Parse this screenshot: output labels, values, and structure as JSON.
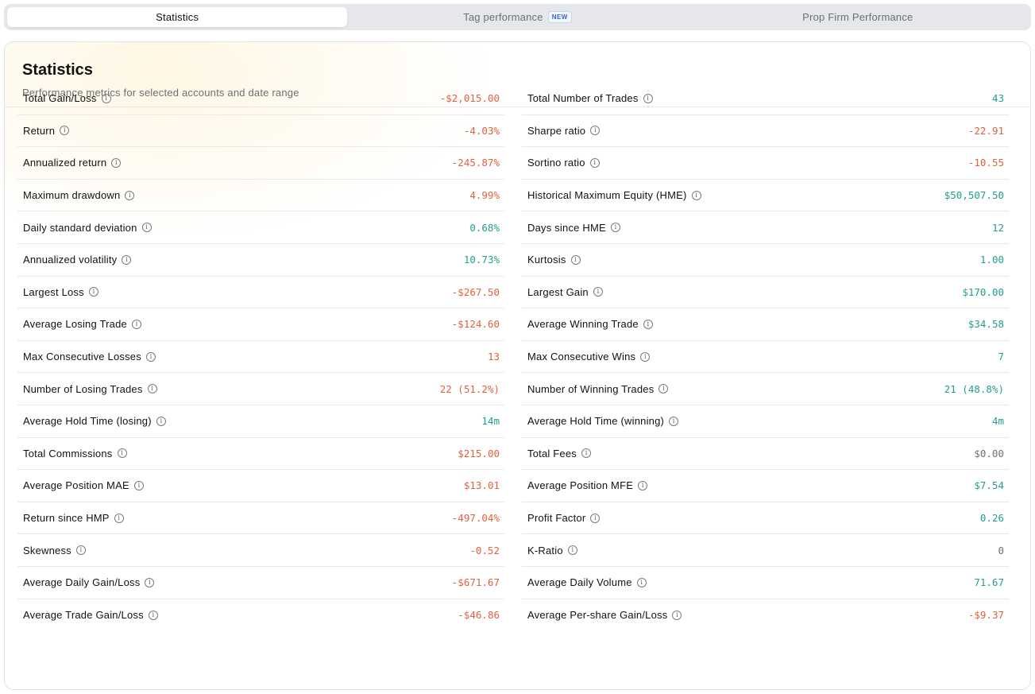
{
  "tabs": [
    {
      "label": "Statistics",
      "active": true
    },
    {
      "label": "Tag performance",
      "badge": "NEW"
    },
    {
      "label": "Prop Firm Performance"
    }
  ],
  "panel": {
    "title": "Statistics",
    "subtitle": "Performance metrics for selected accounts and date range"
  },
  "colors": {
    "negative": "#e0623e",
    "positive": "#229e8f",
    "neutral": "#6b6f76"
  },
  "stats_left": [
    {
      "label": "Total Gain/Loss",
      "value": "-$2,015.00",
      "tone": "neg"
    },
    {
      "label": "Return",
      "value": "-4.03%",
      "tone": "neg"
    },
    {
      "label": "Annualized return",
      "value": "-245.87%",
      "tone": "neg"
    },
    {
      "label": "Maximum drawdown",
      "value": "4.99%",
      "tone": "neg"
    },
    {
      "label": "Daily standard deviation",
      "value": "0.68%",
      "tone": "pos"
    },
    {
      "label": "Annualized volatility",
      "value": "10.73%",
      "tone": "pos"
    },
    {
      "label": "Largest Loss",
      "value": "-$267.50",
      "tone": "neg"
    },
    {
      "label": "Average Losing Trade",
      "value": "-$124.60",
      "tone": "neg"
    },
    {
      "label": "Max Consecutive Losses",
      "value": "13",
      "tone": "neg"
    },
    {
      "label": "Number of Losing Trades",
      "value": "22 (51.2%)",
      "tone": "neg"
    },
    {
      "label": "Average Hold Time (losing)",
      "value": "14m",
      "tone": "pos"
    },
    {
      "label": "Total Commissions",
      "value": "$215.00",
      "tone": "neg"
    },
    {
      "label": "Average Position MAE",
      "value": "$13.01",
      "tone": "neg"
    },
    {
      "label": "Return since HMP",
      "value": "-497.04%",
      "tone": "neg"
    },
    {
      "label": "Skewness",
      "value": "-0.52",
      "tone": "neg"
    },
    {
      "label": "Average Daily Gain/Loss",
      "value": "-$671.67",
      "tone": "neg"
    },
    {
      "label": "Average Trade Gain/Loss",
      "value": "-$46.86",
      "tone": "neg"
    }
  ],
  "stats_right": [
    {
      "label": "Total Number of Trades",
      "value": "43",
      "tone": "pos"
    },
    {
      "label": "Sharpe ratio",
      "value": "-22.91",
      "tone": "neg"
    },
    {
      "label": "Sortino ratio",
      "value": "-10.55",
      "tone": "neg"
    },
    {
      "label": "Historical Maximum Equity (HME)",
      "value": "$50,507.50",
      "tone": "pos"
    },
    {
      "label": "Days since HME",
      "value": "12",
      "tone": "pos"
    },
    {
      "label": "Kurtosis",
      "value": "1.00",
      "tone": "pos"
    },
    {
      "label": "Largest Gain",
      "value": "$170.00",
      "tone": "pos"
    },
    {
      "label": "Average Winning Trade",
      "value": "$34.58",
      "tone": "pos"
    },
    {
      "label": "Max Consecutive Wins",
      "value": "7",
      "tone": "pos"
    },
    {
      "label": "Number of Winning Trades",
      "value": "21 (48.8%)",
      "tone": "pos"
    },
    {
      "label": "Average Hold Time (winning)",
      "value": "4m",
      "tone": "pos"
    },
    {
      "label": "Total Fees",
      "value": "$0.00",
      "tone": "neutral"
    },
    {
      "label": "Average Position MFE",
      "value": "$7.54",
      "tone": "pos"
    },
    {
      "label": "Profit Factor",
      "value": "0.26",
      "tone": "pos"
    },
    {
      "label": "K-Ratio",
      "value": "0",
      "tone": "neutral"
    },
    {
      "label": "Average Daily Volume",
      "value": "71.67",
      "tone": "pos"
    },
    {
      "label": "Average Per-share Gain/Loss",
      "value": "-$9.37",
      "tone": "neg"
    }
  ],
  "icons": {
    "info": "info-circle-icon",
    "info_glyph": "i"
  }
}
